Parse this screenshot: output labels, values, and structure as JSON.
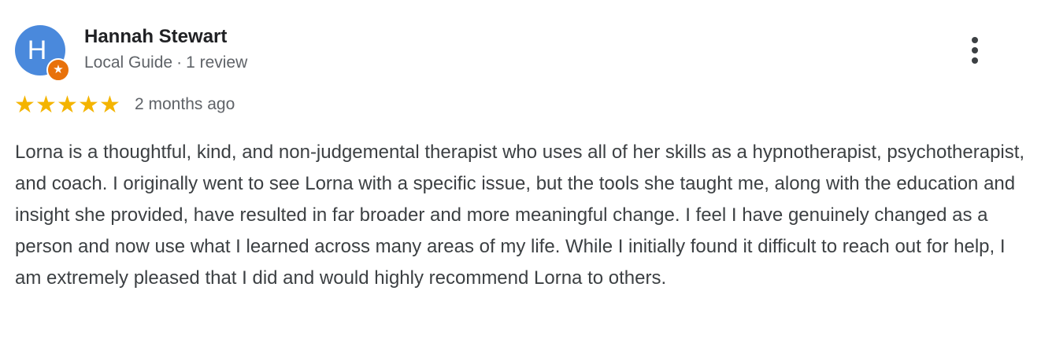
{
  "reviewer": {
    "avatar_initial": "H",
    "avatar_color": "#4a89dc",
    "badge_icon": "local-guide-star-icon",
    "badge_color": "#e8710a",
    "name": "Hannah Stewart",
    "status": "Local Guide",
    "separator": "·",
    "review_count": "1 review"
  },
  "rating": {
    "stars": 5,
    "max": 5,
    "star_color": "#f4b400",
    "star_glyph": "★"
  },
  "date": "2 months ago",
  "menu_icon": "more-vert-icon",
  "review_text": "Lorna is a thoughtful, kind, and non-judgemental therapist who uses all of her skills as a hypnotherapist, psychotherapist, and coach. I originally went to see Lorna with a specific issue, but the tools she taught me, along with the education and insight she provided, have resulted in far broader and more meaningful change. I feel I have genuinely changed as a person and now use what I learned across many areas of my life. While I initially found it difficult to reach out for help, I am extremely pleased that I did and would highly recommend Lorna to others."
}
